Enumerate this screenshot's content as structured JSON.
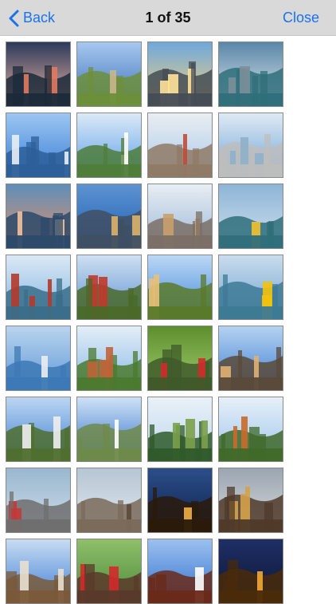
{
  "nav": {
    "back_label": "Back",
    "title": "1 of 35",
    "close_label": "Close"
  },
  "colors": {
    "accent": "#1a73e8",
    "navbar_bg": "#d9d9d9"
  },
  "thumbnails": [
    {
      "scene": "night-coast",
      "sky": [
        "#f2b6a0",
        "#2b3a5c"
      ],
      "ground": "#1b2a3a",
      "accent": "#e07a5f"
    },
    {
      "scene": "beach-resort",
      "sky": [
        "#3a6fb8",
        "#a7c8ef"
      ],
      "ground": "#6d8f3a",
      "accent": "#c9b68a"
    },
    {
      "scene": "sunset-city",
      "sky": [
        "#f5d27a",
        "#6fa8dc"
      ],
      "ground": "#444c55",
      "accent": "#ffe29a"
    },
    {
      "scene": "harbor-towers",
      "sky": [
        "#dfe8ef",
        "#5a87a8"
      ],
      "ground": "#2f6f7a",
      "accent": "#7b8f99"
    },
    {
      "scene": "cable-bridge",
      "sky": [
        "#3b7fd6",
        "#9cc6f2"
      ],
      "ground": "#2d5f9a",
      "accent": "#e8eef5"
    },
    {
      "scene": "hill-tower",
      "sky": [
        "#5aa0e8",
        "#dce9f7"
      ],
      "ground": "#4f7d3a",
      "accent": "#ffffff"
    },
    {
      "scene": "city-aerial",
      "sky": [
        "#a9c8e8",
        "#e9eef2"
      ],
      "ground": "#8f7a66",
      "accent": "#c24a3a"
    },
    {
      "scene": "skyscrapers",
      "sky": [
        "#6fa3d6",
        "#dfeaf4"
      ],
      "ground": "#bdbdbd",
      "accent": "#8fb0c9"
    },
    {
      "scene": "dusk-bridge",
      "sky": [
        "#e8906a",
        "#5e8fb8"
      ],
      "ground": "#2c4a6a",
      "accent": "#f3c2a0"
    },
    {
      "scene": "hotel-tower",
      "sky": [
        "#1f5fb0",
        "#5d93d1"
      ],
      "ground": "#3f4f63",
      "accent": "#d9b36a"
    },
    {
      "scene": "tall-tower",
      "sky": [
        "#9cb7d6",
        "#e8eef4"
      ],
      "ground": "#7a6f66",
      "accent": "#c9a06a"
    },
    {
      "scene": "waterfront",
      "sky": [
        "#cfe0ee",
        "#8db5d6"
      ],
      "ground": "#2f6f7a",
      "accent": "#f2c230"
    },
    {
      "scene": "pier-village",
      "sky": [
        "#7fb3e0",
        "#dbe9f5"
      ],
      "ground": "#3a6e8a",
      "accent": "#b23a2a"
    },
    {
      "scene": "temple-red",
      "sky": [
        "#5a8fd0",
        "#cfe0f2"
      ],
      "ground": "#4a6a2a",
      "accent": "#c0392b"
    },
    {
      "scene": "pagoda-garden",
      "sky": [
        "#3f86d9",
        "#bcd8f5"
      ],
      "ground": "#5a7a2a",
      "accent": "#e8c07a"
    },
    {
      "scene": "yellow-ferry",
      "sky": [
        "#6ea2cf",
        "#c9dced"
      ],
      "ground": "#3d7a95",
      "accent": "#f3c20c"
    },
    {
      "scene": "long-bridge",
      "sky": [
        "#5f98d6",
        "#b9d4ef"
      ],
      "ground": "#3d79b5",
      "accent": "#e9edf2"
    },
    {
      "scene": "village-hills",
      "sky": [
        "#8ab8e4",
        "#e3eef8"
      ],
      "ground": "#4b7a2f",
      "accent": "#c0643a"
    },
    {
      "scene": "funicular",
      "sky": [
        "#9ccb6a",
        "#5e8f2f"
      ],
      "ground": "#3f5a2a",
      "accent": "#d12a2a"
    },
    {
      "scene": "pagoda-sky",
      "sky": [
        "#3d7fd1",
        "#b5d2f1"
      ],
      "ground": "#5a4a3a",
      "accent": "#e0b070"
    },
    {
      "scene": "lighthouse",
      "sky": [
        "#3f7fd0",
        "#bcd6f2"
      ],
      "ground": "#4f6f2f",
      "accent": "#eeeeee"
    },
    {
      "scene": "white-church",
      "sky": [
        "#2f6fc9",
        "#cfe2f6"
      ],
      "ground": "#6f8a4a",
      "accent": "#ffffff"
    },
    {
      "scene": "forest-hill",
      "sky": [
        "#bcd6ec",
        "#e9f1f8"
      ],
      "ground": "#2f5a2a",
      "accent": "#7aa04a"
    },
    {
      "scene": "temple-terraces",
      "sky": [
        "#9fc4ea",
        "#e6f0f9"
      ],
      "ground": "#3f6a2a",
      "accent": "#c96a2a"
    },
    {
      "scene": "coastal-town",
      "sky": [
        "#cfdde9",
        "#9ab7cf"
      ],
      "ground": "#6f6f6f",
      "accent": "#c23a3a"
    },
    {
      "scene": "mosque",
      "sky": [
        "#dfe7ee",
        "#b7c6d4"
      ],
      "ground": "#7a6a5a",
      "accent": "#5a4a3a"
    },
    {
      "scene": "twin-towers-night",
      "sky": [
        "#0f1f4a",
        "#2c4f8a"
      ],
      "ground": "#2a1a0a",
      "accent": "#f0b040"
    },
    {
      "scene": "pagoda-dusk",
      "sky": [
        "#d9d9d9",
        "#9aa6b2"
      ],
      "ground": "#4f3a2a",
      "accent": "#d4a24a"
    },
    {
      "scene": "ornate-tower",
      "sky": [
        "#3d7ed6",
        "#c8dcf2"
      ],
      "ground": "#7a5a3a",
      "accent": "#e8e0d0"
    },
    {
      "scene": "chinese-temple",
      "sky": [
        "#4c8a3a",
        "#8fbf6a"
      ],
      "ground": "#5a3a2a",
      "accent": "#d12a2a"
    },
    {
      "scene": "white-pagoda",
      "sky": [
        "#2f6fd0",
        "#9cc1ee"
      ],
      "ground": "#6a2a1a",
      "accent": "#ffffff"
    },
    {
      "scene": "golden-palace",
      "sky": [
        "#0c1633",
        "#1f2f66"
      ],
      "ground": "#4a2a0a",
      "accent": "#f2a830"
    }
  ]
}
